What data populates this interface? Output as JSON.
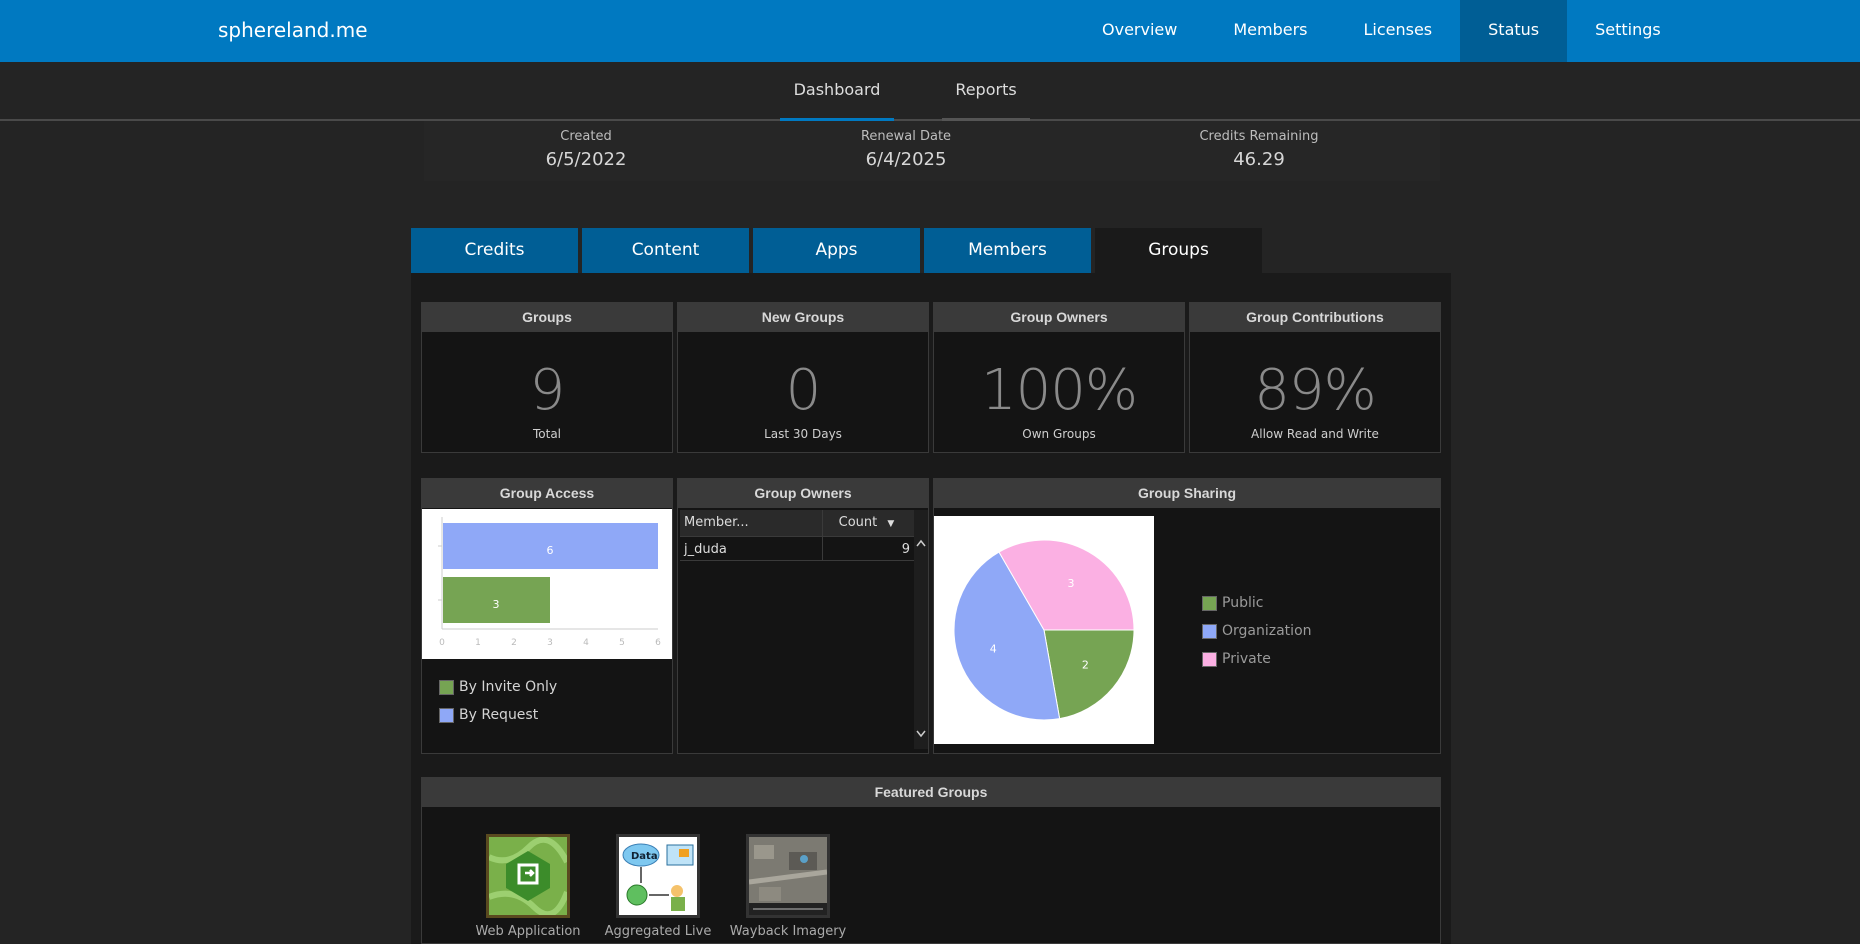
{
  "app": {
    "brand": "sphereland.me"
  },
  "topnav": [
    "Overview",
    "Members",
    "Licenses",
    "Status",
    "Settings"
  ],
  "topnav_active": "Status",
  "subtabs": [
    "Dashboard",
    "Reports"
  ],
  "subtab_active": "Dashboard",
  "stats": {
    "created_label": "Created",
    "created_value": "6/5/2022",
    "renewal_label": "Renewal Date",
    "renewal_value": "6/4/2025",
    "credits_label": "Credits Remaining",
    "credits_value": "46.29"
  },
  "tabs": [
    "Credits",
    "Content",
    "Apps",
    "Members",
    "Groups"
  ],
  "tab_active": "Groups",
  "kpis": [
    {
      "title": "Groups",
      "value": "9",
      "sub": "Total"
    },
    {
      "title": "New Groups",
      "value": "0",
      "sub": "Last 30 Days"
    },
    {
      "title": "Group Owners",
      "value": "100%",
      "sub": "Own Groups"
    },
    {
      "title": "Group Contributions",
      "value": "89%",
      "sub": "Allow Read and Write"
    }
  ],
  "group_access": {
    "title": "Group Access",
    "legend": [
      "By Invite Only",
      "By Request"
    ]
  },
  "group_owners": {
    "title": "Group Owners",
    "columns": [
      "Member...",
      "Count"
    ],
    "rows": [
      {
        "member": "j_duda",
        "count": "9"
      }
    ]
  },
  "group_sharing": {
    "title": "Group Sharing",
    "legend": [
      "Public",
      "Organization",
      "Private"
    ]
  },
  "featured": {
    "title": "Featured Groups",
    "items": [
      "Web Application",
      "Aggregated Live",
      "Wayback Imagery"
    ]
  },
  "colors": {
    "green": "#76a453",
    "blue": "#8fa8f7",
    "pink": "#fbb0e3",
    "accent": "#0079c1"
  },
  "chart_data": [
    {
      "type": "bar",
      "orientation": "horizontal",
      "categories": [
        "By Request",
        "By Invite Only"
      ],
      "values": [
        6,
        3
      ],
      "xlim": [
        0,
        6
      ],
      "xticks": [
        "0",
        "1",
        "2",
        "3",
        "4",
        "5",
        "6"
      ],
      "colors": [
        "#8fa8f7",
        "#76a453"
      ]
    },
    {
      "type": "pie",
      "labels": [
        "Public",
        "Organization",
        "Private"
      ],
      "values": [
        2,
        4,
        3
      ],
      "colors": [
        "#76a453",
        "#8fa8f7",
        "#fbb0e3"
      ]
    }
  ]
}
